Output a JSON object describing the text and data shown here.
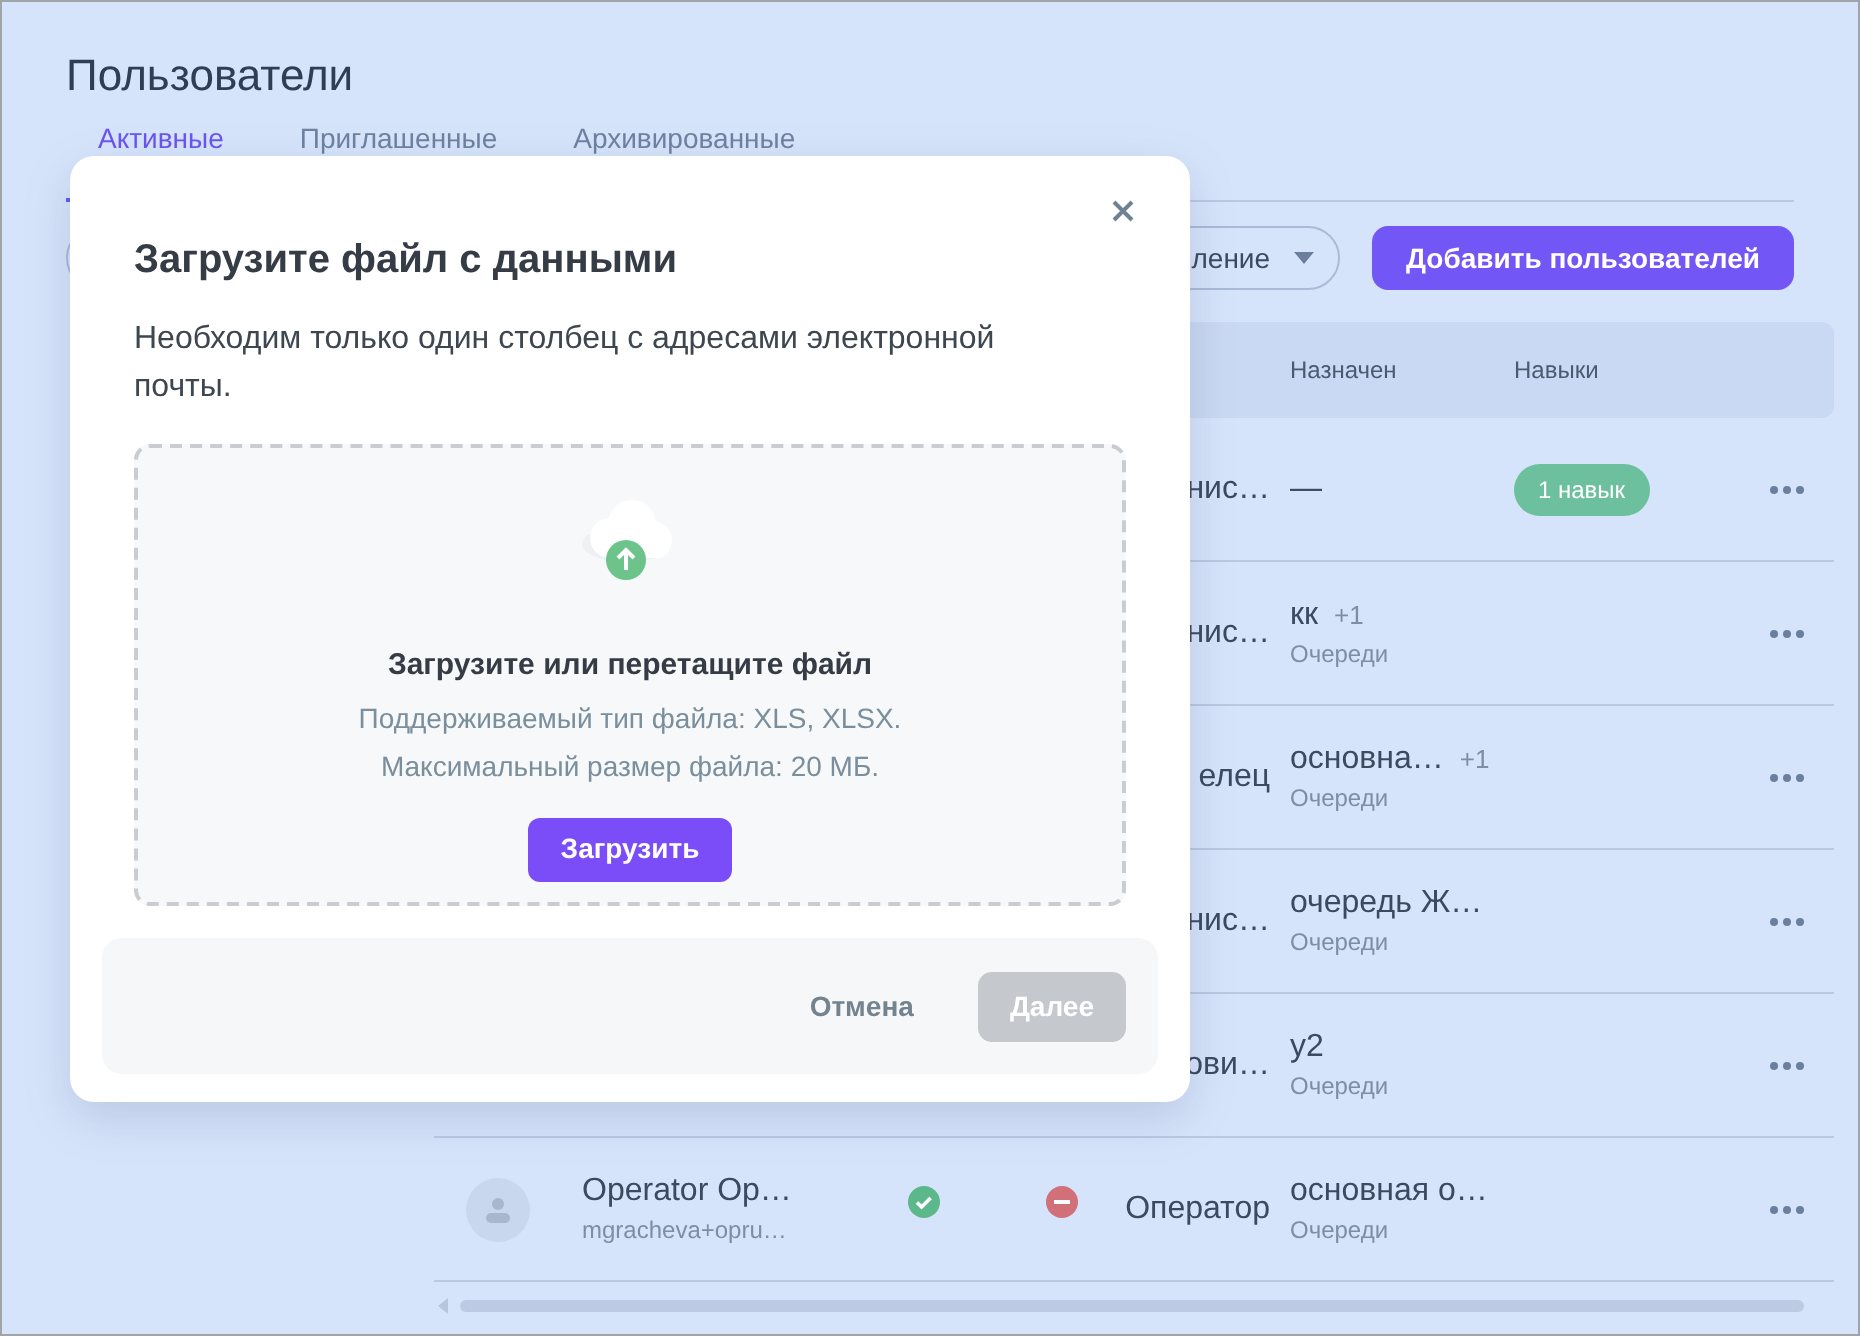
{
  "page": {
    "title": "Пользователи",
    "tabs": [
      {
        "label": "Активные",
        "selected": true
      },
      {
        "label": "Приглашенные",
        "selected": false
      },
      {
        "label": "Архивированные",
        "selected": false
      }
    ],
    "filter": {
      "value": "ление"
    },
    "add_button": "Добавить пользователей"
  },
  "table": {
    "columns": [
      "Назначен",
      "Навыки"
    ],
    "rows": [
      {
        "role": "нис…",
        "assigned": "—",
        "skills": "1 навык"
      },
      {
        "role": "нис…",
        "assigned": "кк",
        "more": "+1",
        "assigned_label": "Очереди"
      },
      {
        "role": "елец",
        "assigned": "основна…",
        "more": "+1",
        "assigned_label": "Очереди"
      },
      {
        "role": "нис…",
        "assigned": "очередь Ж…",
        "assigned_label": "Очереди"
      },
      {
        "role": "ови…",
        "assigned": "у2",
        "assigned_label": "Очереди"
      },
      {
        "name": "Operator Op…",
        "email": "mgracheva+opru…",
        "confirmed": true,
        "blocked": true,
        "role": "Оператор",
        "assigned": "основная о…",
        "assigned_label": "Очереди"
      }
    ]
  },
  "dialog": {
    "title": "Загрузите файл с данными",
    "description": "Необходим только один столбец с адресами электронной почты.",
    "dropzone": {
      "heading": "Загрузите или перетащите файл",
      "hints": [
        "Поддерживаемый тип файла: XLS, XLSX.",
        "Максимальный размер файла: 20 МБ."
      ],
      "button": "Загрузить"
    },
    "cancel": "Отмена",
    "next": {
      "label": "Далее",
      "disabled": true
    }
  }
}
